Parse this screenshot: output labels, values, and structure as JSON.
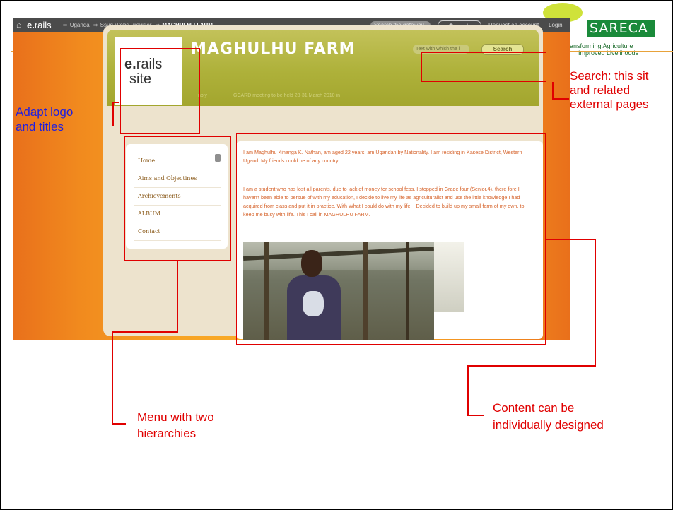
{
  "topbar": {
    "brand_e": "e.",
    "brand_rest": "rails",
    "breadcrumbs": [
      "Uganda",
      "Ssug Webs Provider",
      "MAGHULHU FARM"
    ],
    "gateway_search_placeholder": "Search the gateway",
    "search_button": "Search",
    "request_account": "Request an account",
    "login": "Login"
  },
  "brand_logo": {
    "name": "SARECA",
    "tagline_1": "ansforming Agriculture",
    "tagline_2": "Improved Livelihoods"
  },
  "site": {
    "logo_e": "e.",
    "logo_rails": "rails",
    "logo_site": "site",
    "title": "MAGHULHU FARM",
    "search_placeholder": "Text with which the l",
    "search_button": "Search",
    "ticker_a": "nbly",
    "ticker_b": "GCARD meeting to be held 28-31 March 2010 in"
  },
  "menu": {
    "items": [
      "Home",
      "Aims and Objectines",
      "Archievements",
      "ALBUM",
      "Contact"
    ]
  },
  "content": {
    "paragraph_1": "I am Maghulhu Kinanga K. Nathan, am aged 22 years, am Ugandan by Nationality. I am residing in Kasese District, Western Ugand. My friends could be of any country.",
    "paragraph_2": "I am a student who has lost all parents, due to lack of money for school fess, I stopped in Grade four (Senior.4), there fore I haven't been able to persue of with my education, I decide to live my life as agriculturalist and use the little knowledge I had acquired from class and put it in practice. With What I could do with my life, I Decided to build up my small farm of my own, to keep me busy with life. This I call in MAGHULHU FARM."
  },
  "annotations": {
    "logo_line1": "Adapt logo",
    "logo_line2": "and titles",
    "search_line1": "Search: this sit",
    "search_line2": "and related",
    "search_line3": "external pages",
    "menu_line1": "Menu with two",
    "menu_line2": "hierarchies",
    "content_line1": "Content can be",
    "content_line2": "individually designed"
  },
  "colors": {
    "annotation_red": "#e00000",
    "annotation_blue": "#2020e0",
    "orange_bg": "#f18a1e",
    "header_olive": "#aeb13a"
  }
}
